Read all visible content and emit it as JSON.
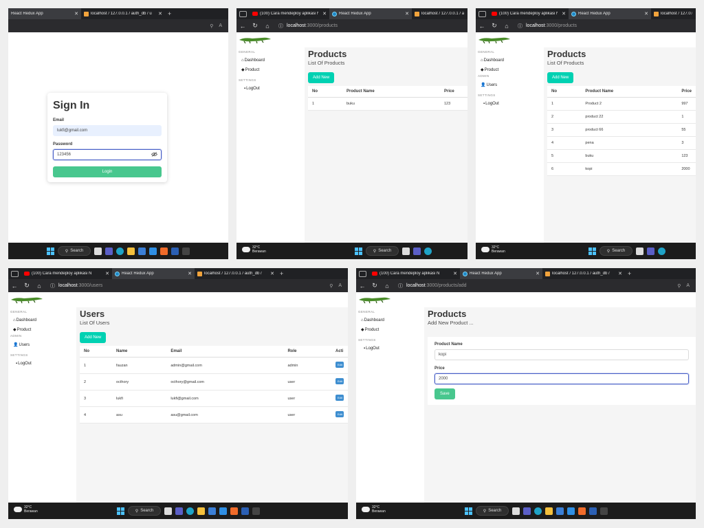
{
  "common": {
    "tab_react": "React Redux App",
    "tab_youtube": "(100) Cara mendeploy aplikasi N",
    "tab_pma": "localhost / 127.0.0.1 / auth_db / u",
    "tab_pma_short": "localhost / 127.0.0.1 / auth_db /",
    "url_host": "localhost",
    "sidebar": {
      "general": "GENERAL",
      "dashboard": "Dashboard",
      "product": "Product",
      "admin": "ADMIN",
      "users": "Users",
      "settings": "SETTINGS",
      "logout": "LogOut"
    },
    "weather": {
      "temp": "32°C",
      "desc": "Berawan"
    },
    "taskbar_search": "Search"
  },
  "s1": {
    "title": "Sign In",
    "email_label": "Email",
    "email_value": "lukfi@gmail.com",
    "password_label": "Password",
    "password_value": "123456",
    "login_label": "Login"
  },
  "s2": {
    "url_path": ":3000/products",
    "title": "Products",
    "subtitle": "List Of Products",
    "add_label": "Add New",
    "columns": [
      "No",
      "Product Name",
      "Price"
    ],
    "rows": [
      [
        "1",
        "buku",
        "123"
      ]
    ]
  },
  "s3": {
    "url_path": ":3000/products",
    "title": "Products",
    "subtitle": "List Of Products",
    "add_label": "Add New",
    "columns": [
      "No",
      "Product Name",
      "Price"
    ],
    "rows": [
      [
        "1",
        "Product 2",
        "997"
      ],
      [
        "2",
        "product 22",
        "1"
      ],
      [
        "3",
        "product 66",
        "55"
      ],
      [
        "4",
        "pena",
        "3"
      ],
      [
        "5",
        "buku",
        "123"
      ],
      [
        "6",
        "kopi",
        "2000"
      ]
    ]
  },
  "s4": {
    "url_path": ":3000/users",
    "title": "Users",
    "subtitle": "List Of Users",
    "add_label": "Add New",
    "columns": [
      "No",
      "Name",
      "Email",
      "Role",
      "Acti"
    ],
    "rows": [
      [
        "1",
        "fauzan",
        "admin@gmail.com",
        "admin"
      ],
      [
        "2",
        "octhory",
        "octhory@gmail.com",
        "user"
      ],
      [
        "3",
        "lukfi",
        "lukfi@gmail.com",
        "user"
      ],
      [
        "4",
        "asu",
        "asu@gmail.com",
        "user"
      ]
    ],
    "edit_label": "Edit"
  },
  "s5": {
    "url_path": ":3000/products/add",
    "title": "Products",
    "subtitle": "Add New Product ...",
    "name_label": "Product Name",
    "name_value": "kopi",
    "price_label": "Price",
    "price_value": "2000",
    "save_label": "Save"
  },
  "colors": {
    "teal_button": "#00d1b2",
    "green_button": "#48c78e",
    "edit_blue": "#3e8ed0",
    "taskbar": "#1c1c1c",
    "browser_chrome": "#202124"
  }
}
